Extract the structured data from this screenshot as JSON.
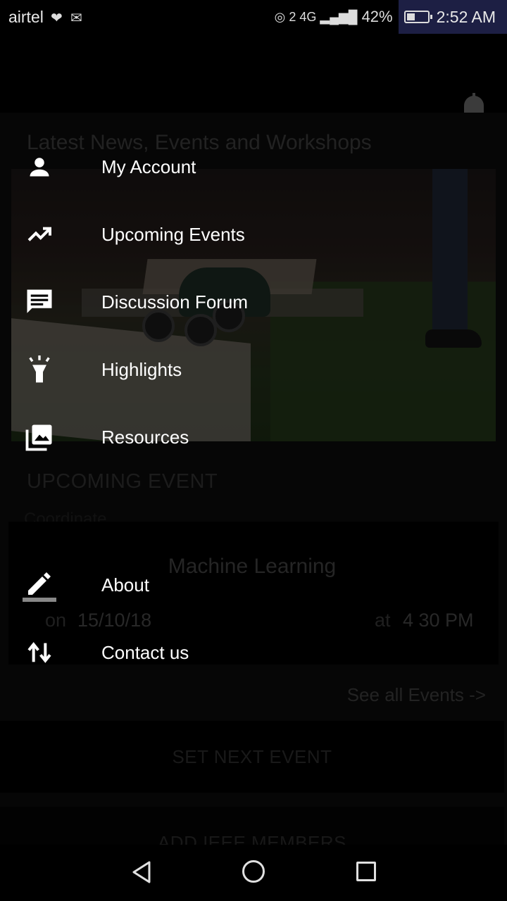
{
  "status_bar": {
    "carrier": "airtel",
    "icons": [
      "heart-monitor-icon",
      "mail-icon"
    ],
    "network": "2 4G",
    "battery_percent": "42%",
    "battery_level": 0.42,
    "time": "2:52 AM"
  },
  "app_bar": {
    "notification_icon": "bell-icon"
  },
  "main": {
    "news_heading": "Latest News, Events and Workshops",
    "upcoming_label": "UPCOMING EVENT",
    "upcoming_sub": "Coordinate",
    "event": {
      "title": "Machine Learning",
      "on_label": "on",
      "date": "15/10/18",
      "at_label": "at",
      "time": "4 30 PM"
    },
    "see_all": "See all Events ->",
    "set_next_event": "SET NEXT EVENT",
    "add_members": "ADD IEEE MEMBERS"
  },
  "drawer": {
    "items": [
      {
        "label": "My Account",
        "icon": "person-icon"
      },
      {
        "label": "Upcoming Events",
        "icon": "trending-up-icon"
      },
      {
        "label": "Discussion Forum",
        "icon": "chat-icon"
      },
      {
        "label": "Highlights",
        "icon": "flashlight-icon"
      },
      {
        "label": "Resources",
        "icon": "photo-library-icon"
      },
      {
        "label": "About",
        "icon": "pencil-icon"
      },
      {
        "label": "Contact us",
        "icon": "swap-vert-icon"
      }
    ]
  },
  "nav_bar": {
    "icons": [
      "back-icon",
      "home-icon",
      "recents-icon"
    ]
  }
}
